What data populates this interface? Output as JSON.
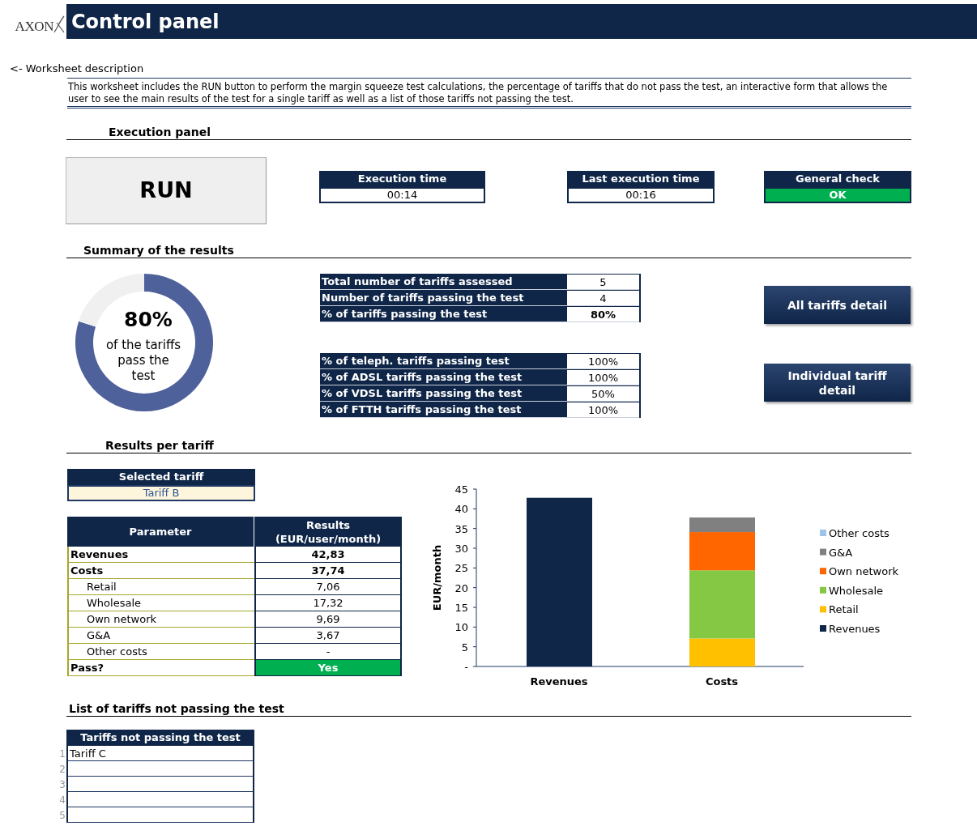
{
  "header": {
    "logo": "AXON",
    "title": "Control panel"
  },
  "description": {
    "link": "<- Worksheet description",
    "text": "This worksheet includes the RUN button to perform the margin squeeze test calculations, the percentage of tariffs that do not pass the test, an interactive form that allows the user to see the main results of the test for a single tariff as well as a list of those tariffs not passing the test."
  },
  "execution_panel": {
    "heading": "Execution panel",
    "run_button": "RUN",
    "indicators": [
      {
        "label": "Execution time",
        "value": "00:14",
        "kind": "time"
      },
      {
        "label": "Last execution time",
        "value": "00:16",
        "kind": "time"
      },
      {
        "label": "General check",
        "value": "OK",
        "kind": "check"
      }
    ]
  },
  "summary": {
    "heading": "Summary of the results",
    "donut": {
      "chart_data": {
        "type": "donut",
        "values": [
          80,
          20
        ]
      },
      "value": "80%",
      "caption": "of the tariffs pass the test"
    },
    "totals": [
      {
        "label": "Total number of tariffs assessed",
        "value": "5",
        "bold": false
      },
      {
        "label": "Number of tariffs passing the test",
        "value": "4",
        "bold": false
      },
      {
        "label": "% of tariffs passing the test",
        "value": "80%",
        "bold": true
      }
    ],
    "by_technology": [
      {
        "label": "% of teleph. tariffs passing test",
        "value": "100%"
      },
      {
        "label": "% of ADSL tariffs passing the test",
        "value": "100%"
      },
      {
        "label": "% of VDSL tariffs passing the test",
        "value": "50%"
      },
      {
        "label": "% of FTTH tariffs passing the test",
        "value": "100%"
      }
    ],
    "buttons": [
      "All tariffs detail",
      "Individual tariff detail"
    ]
  },
  "results": {
    "heading": "Results per tariff",
    "selected_tariff": {
      "label": "Selected tariff",
      "value": "Tariff B"
    },
    "table": {
      "columns": [
        "Parameter",
        "Results (EUR/user/month)"
      ],
      "rows": [
        {
          "parameter": "Revenues",
          "result": "42,83",
          "kind": "total"
        },
        {
          "parameter": "Costs",
          "result": "37,74",
          "kind": "total"
        },
        {
          "parameter": "Retail",
          "result": "7,06",
          "kind": "item"
        },
        {
          "parameter": "Wholesale",
          "result": "17,32",
          "kind": "item"
        },
        {
          "parameter": "Own network",
          "result": "9,69",
          "kind": "item"
        },
        {
          "parameter": "G&A",
          "result": "3,67",
          "kind": "item"
        },
        {
          "parameter": "Other costs",
          "result": "-",
          "kind": "item"
        },
        {
          "parameter": "Pass?",
          "result": "Yes",
          "kind": "pass"
        }
      ]
    },
    "chart_data": {
      "type": "bar",
      "stacked": true,
      "legend": true,
      "ylabel": "EUR/month",
      "categories": [
        "Revenues",
        "Costs"
      ],
      "ylim": [
        0,
        45
      ],
      "yticks": [
        {
          "value": 0,
          "label": "-"
        },
        5,
        10,
        15,
        20,
        25,
        30,
        35,
        40,
        45
      ],
      "series": [
        {
          "name": "Revenues",
          "color": "#0f2648",
          "values": [
            42.8,
            null
          ]
        },
        {
          "name": "Retail",
          "color": "#ffc000",
          "values": [
            null,
            7.1
          ]
        },
        {
          "name": "Wholesale",
          "color": "#84c844",
          "values": [
            null,
            17.3
          ]
        },
        {
          "name": "Own network",
          "color": "#ff6600",
          "values": [
            null,
            9.7
          ]
        },
        {
          "name": "G&A",
          "color": "#808080",
          "values": [
            null,
            3.7
          ]
        },
        {
          "name": "Other costs",
          "color": "#9dc3e6",
          "values": [
            null,
            0
          ]
        }
      ]
    }
  },
  "failing": {
    "heading": "List of tariffs not passing the test",
    "column": "Tariffs not passing the test",
    "rows": [
      {
        "number": "1",
        "tariff": "Tariff C"
      },
      {
        "number": "2"
      },
      {
        "number": "3"
      },
      {
        "number": "4"
      },
      {
        "number": "5"
      }
    ]
  }
}
